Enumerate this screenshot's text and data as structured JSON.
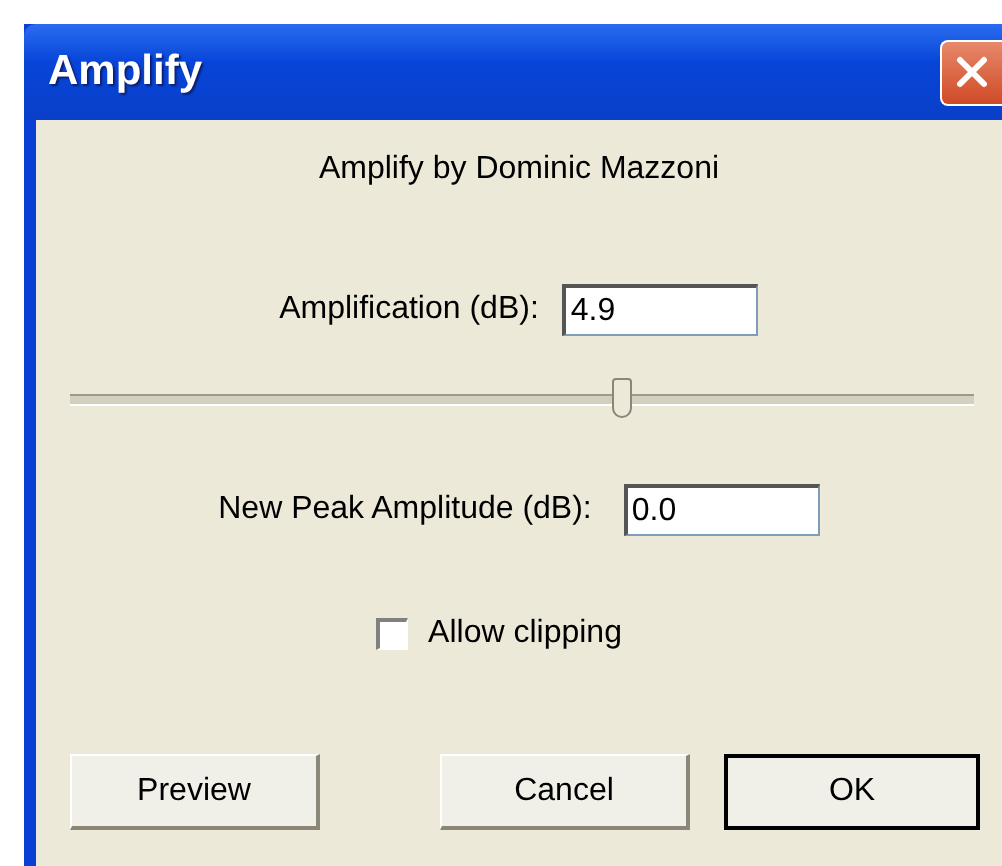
{
  "window": {
    "title": "Amplify"
  },
  "credit": "Amplify by Dominic Mazzoni",
  "amplification": {
    "label": "Amplification (dB):",
    "value": "4.9"
  },
  "slider": {
    "level": 0.61
  },
  "new_peak": {
    "label": "New Peak Amplitude (dB):",
    "value": "0.0"
  },
  "allow_clipping": {
    "label": "Allow clipping",
    "checked": false
  },
  "buttons": [
    {
      "label": "Preview",
      "default": false
    },
    {
      "label": "Cancel",
      "default": false
    },
    {
      "label": "OK",
      "default": true
    }
  ]
}
